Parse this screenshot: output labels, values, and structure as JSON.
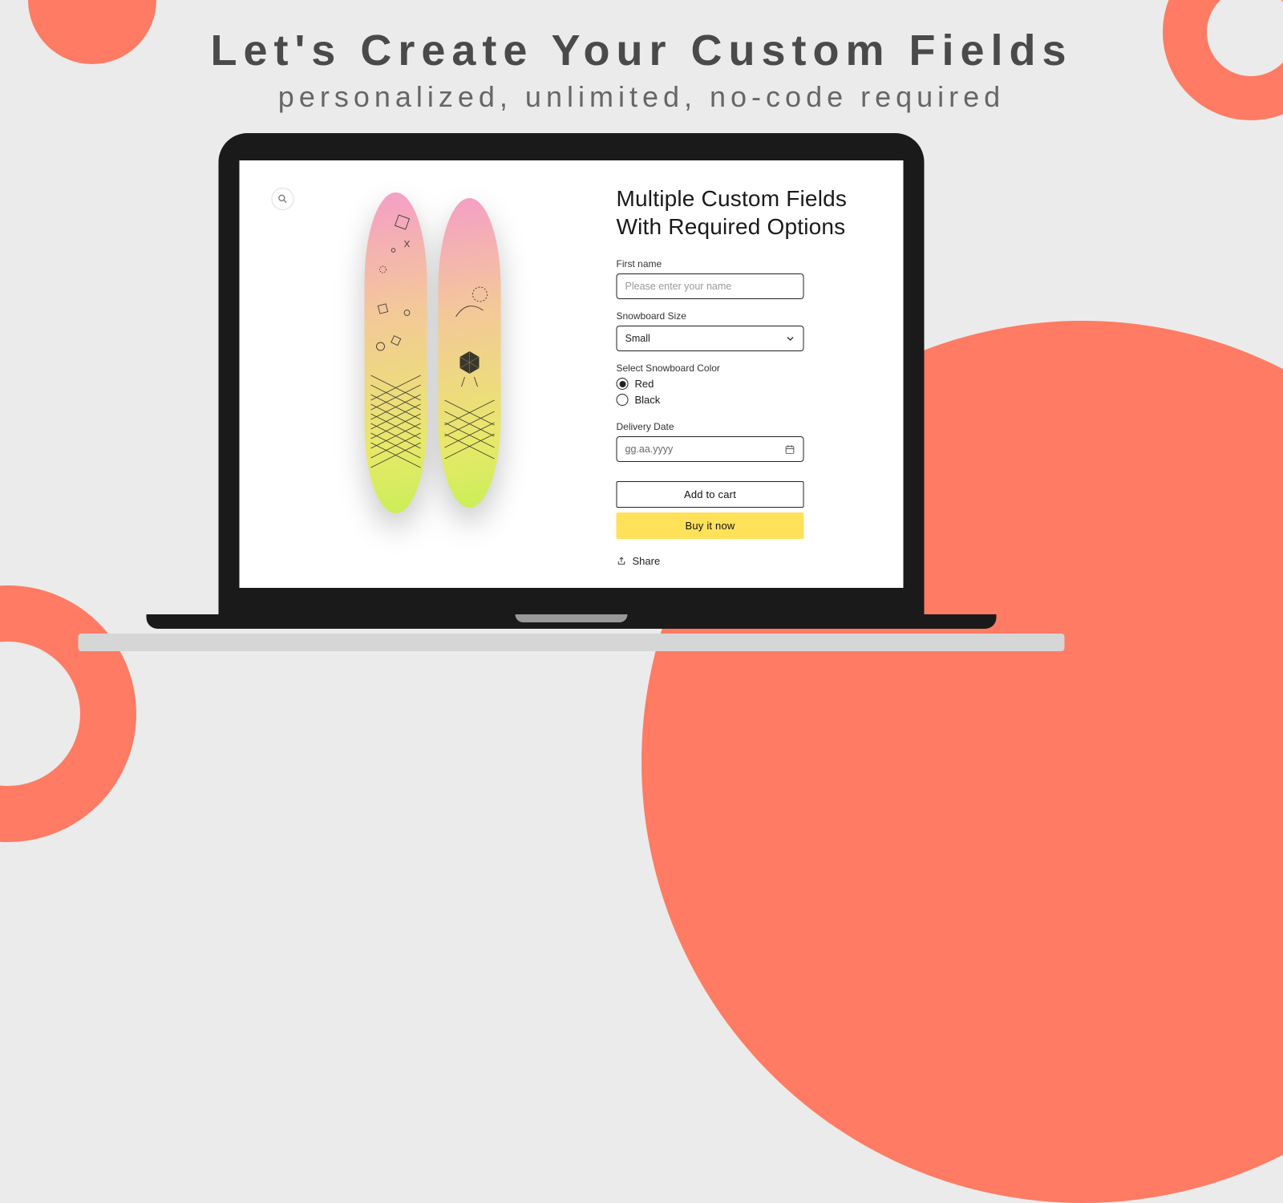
{
  "hero": {
    "title": "Let's Create Your Custom Fields",
    "subtitle": "personalized, unlimited, no-code required"
  },
  "product": {
    "title": "Multiple Custom Fields With Required Options",
    "fields": {
      "first_name": {
        "label": "First name",
        "placeholder": "Please enter your name"
      },
      "size": {
        "label": "Snowboard Size",
        "value": "Small"
      },
      "color": {
        "label": "Select Snowboard Color",
        "options": [
          {
            "label": "Red",
            "checked": true
          },
          {
            "label": "Black",
            "checked": false
          }
        ]
      },
      "delivery": {
        "label": "Delivery Date",
        "placeholder": "gg.aa.yyyy"
      }
    },
    "buttons": {
      "add": "Add to cart",
      "buy": "Buy it now"
    },
    "share": "Share"
  }
}
